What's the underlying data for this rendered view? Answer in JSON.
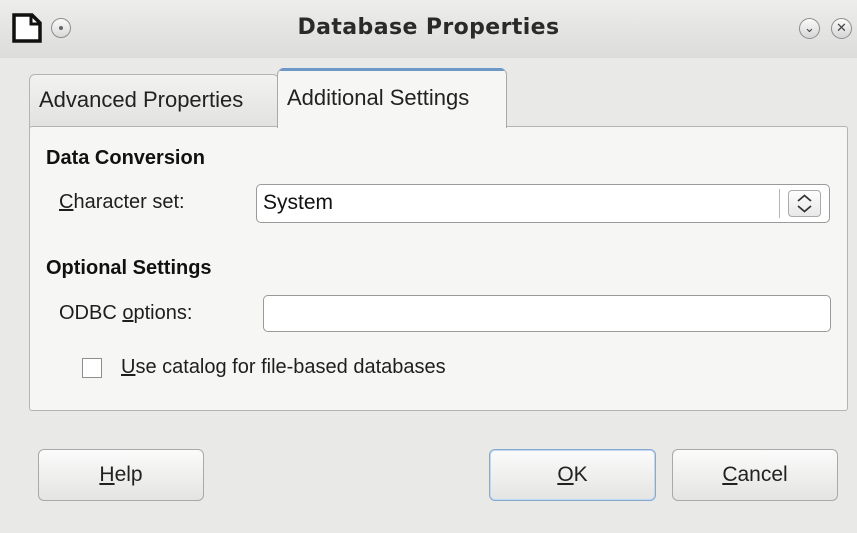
{
  "window": {
    "title": "Database Properties",
    "controls": {
      "minimize_icon": "chevron-down-icon",
      "close_icon": "close-icon"
    }
  },
  "tabs": [
    {
      "label": "Advanced Properties",
      "active": false
    },
    {
      "label": "Additional Settings",
      "active": true
    }
  ],
  "data_conversion": {
    "heading": "Data Conversion",
    "charset_label_mnemonic": "C",
    "charset_label_rest": "haracter set:",
    "charset_value": "System"
  },
  "optional_settings": {
    "heading": "Optional Settings",
    "odbc_label_pre": "ODBC ",
    "odbc_label_mnemonic": "o",
    "odbc_label_rest": "ptions:",
    "odbc_value": "",
    "catalog_label_mnemonic": "U",
    "catalog_label_rest": "se catalog for file-based databases",
    "catalog_checked": false
  },
  "buttons": {
    "help_mnemonic": "H",
    "help_rest": "elp",
    "ok_mnemonic": "O",
    "ok_rest": "K",
    "cancel_mnemonic": "C",
    "cancel_rest": "ancel"
  },
  "colors": {
    "accent": "#6d98c7",
    "window_bg": "#e9e9e7",
    "panel_bg": "#f6f6f5"
  }
}
